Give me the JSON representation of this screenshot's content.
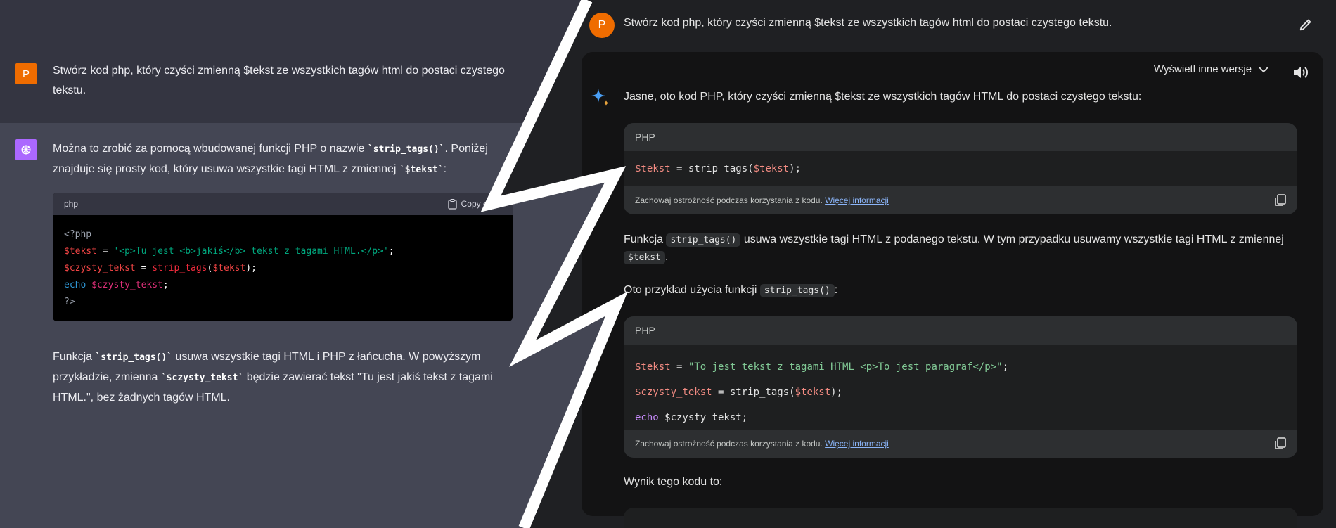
{
  "left": {
    "user_avatar": "P",
    "user_message": "Stwórz kod php, który czyści zmienną $tekst ze wszystkich tagów html do postaci czystego tekstu.",
    "assistant_p1_a": "Można to zrobić za pomocą wbudowanej funkcji PHP o nazwie ",
    "assistant_p1_code1": "`strip_tags()`",
    "assistant_p1_b": ". Poniżej znajduje się prosty kod, który usuwa wszystkie tagi HTML z zmiennej ",
    "assistant_p1_code2": "`$tekst`",
    "assistant_p1_c": ":",
    "code_lang": "php",
    "copy_label": "Copy code",
    "code": {
      "line1": "<?php",
      "line2_var": "$tekst",
      "line2_eq": " = ",
      "line2_str": "'<p>Tu jest <b>jakiś</b> tekst z tagami HTML.</p>'",
      "line2_end": ";",
      "line3_var": "$czysty_tekst",
      "line3_eq": " = ",
      "line3_fn": "strip_tags",
      "line3_p1": "(",
      "line3_arg": "$tekst",
      "line3_p2": ");",
      "line4_kw": "echo",
      "line4_var": " $czysty_tekst",
      "line4_end": ";",
      "line5": "?>"
    },
    "assistant_p2_a": "Funkcja ",
    "assistant_p2_code1": "`strip_tags()`",
    "assistant_p2_b": " usuwa wszystkie tagi HTML i PHP z łańcucha. W powyższym przykładzie, zmienna ",
    "assistant_p2_code2": "`$czysty_tekst`",
    "assistant_p2_c": " będzie zawierać tekst \"Tu jest jakiś tekst z tagami HTML.\", bez żadnych tagów HTML."
  },
  "right": {
    "user_avatar": "P",
    "user_message": "Stwórz kod php, który czyści zmienną $tekst ze wszystkich tagów html do postaci czystego tekstu.",
    "drafts_label": "Wyświetl inne wersje",
    "intro": "Jasne, oto kod PHP, który czyści zmienną $tekst ze wszystkich tagów HTML do postaci czystego tekstu:",
    "code1_lang": "PHP",
    "code1": {
      "var": "$tekst",
      "eq": " = strip_tags(",
      "arg": "$tekst",
      "end": ");"
    },
    "caution": "Zachowaj ostrożność podczas korzystania z kodu.",
    "more_info": "Więcej informacji",
    "p2_a": "Funkcja ",
    "p2_code1": "strip_tags()",
    "p2_b": " usuwa wszystkie tagi HTML z podanego tekstu. W tym przypadku usuwamy wszystkie tagi HTML z zmiennej ",
    "p2_code2": "$tekst",
    "p2_c": ".",
    "p3_a": "Oto przykład użycia funkcji ",
    "p3_code": "strip_tags()",
    "p3_b": ":",
    "code2_lang": "PHP",
    "code2": {
      "l1_var": "$tekst",
      "l1_eq": " = ",
      "l1_str": "\"To jest tekst z tagami HTML <p>To jest paragraf</p>\"",
      "l1_end": ";",
      "l2_var": "$czysty_tekst",
      "l2_eq": " = strip_tags(",
      "l2_arg": "$tekst",
      "l2_end": ");",
      "l3_kw": "echo",
      "l3_var": " $czysty_tekst",
      "l3_end": ";"
    },
    "result_label": "Wynik tego kodu to:"
  }
}
